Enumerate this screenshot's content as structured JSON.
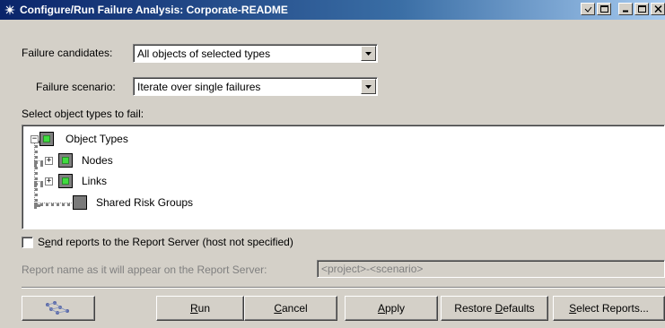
{
  "window": {
    "title": "Configure/Run Failure Analysis: Corporate-README",
    "title_icon": "star-icon",
    "buttons": [
      "restore-icon",
      "maximize-icon",
      "minimize-icon",
      "maximize-icon",
      "close-icon"
    ]
  },
  "failure_candidates": {
    "label": "Failure candidates:",
    "value": "All objects of selected types"
  },
  "failure_scenario": {
    "label": "Failure scenario:",
    "value": "Iterate over single failures"
  },
  "object_types": {
    "label": "Select object types to fail:",
    "tree": [
      {
        "label": "Object Types",
        "level": 0,
        "state": "partial",
        "expander": "−"
      },
      {
        "label": "Nodes",
        "level": 1,
        "state": "partial",
        "expander": "+"
      },
      {
        "label": "Links",
        "level": 1,
        "state": "partial",
        "expander": "+"
      },
      {
        "label": "Shared Risk Groups",
        "level": 1,
        "state": "unchecked",
        "expander": ""
      }
    ]
  },
  "send_reports": {
    "label_pre": "S",
    "label_ul": "e",
    "label_post": "nd reports to the Report Server (host not specified)",
    "checked": false
  },
  "report_name": {
    "label": "Report name as it will appear on the Report Server:",
    "value": "<project>-<scenario>"
  },
  "footer": {
    "run": {
      "ul": "R",
      "rest": "un"
    },
    "cancel": {
      "ul": "C",
      "rest": "ancel"
    },
    "apply": {
      "ul": "A",
      "rest": "pply"
    },
    "restore": {
      "pre": "Restore ",
      "ul": "D",
      "rest": "efaults"
    },
    "select": {
      "ul": "S",
      "rest": "elect Reports..."
    }
  },
  "colors": {
    "titlebar_start": "#0a246a",
    "titlebar_end": "#a6caf0",
    "checkbox_green": "#3fdc3f"
  }
}
